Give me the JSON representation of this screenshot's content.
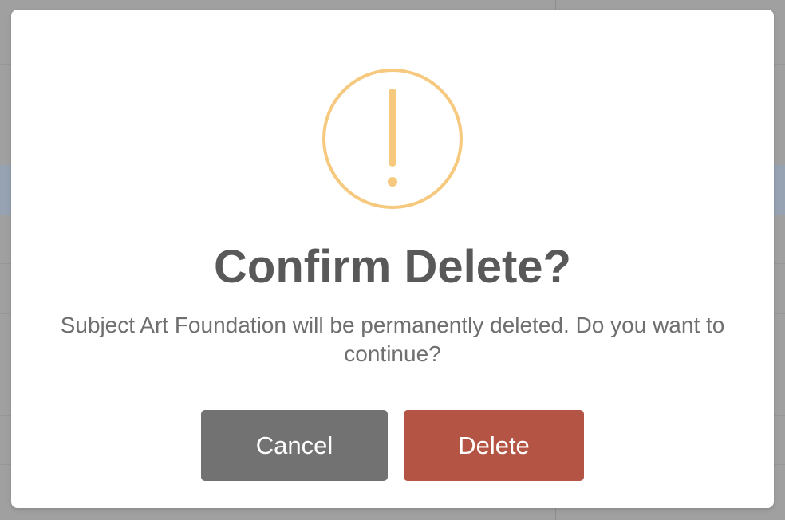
{
  "dialog": {
    "title": "Confirm Delete?",
    "message": "Subject Art Foundation will be permanently deleted. Do you want to continue?",
    "icon": "warning-exclamation-icon",
    "cancel_label": "Cancel",
    "delete_label": "Delete"
  },
  "colors": {
    "warning_icon": "#f6c97f",
    "cancel_button": "#727272",
    "delete_button": "#b45444",
    "title_text": "#595959",
    "message_text": "#6f6f6f"
  }
}
